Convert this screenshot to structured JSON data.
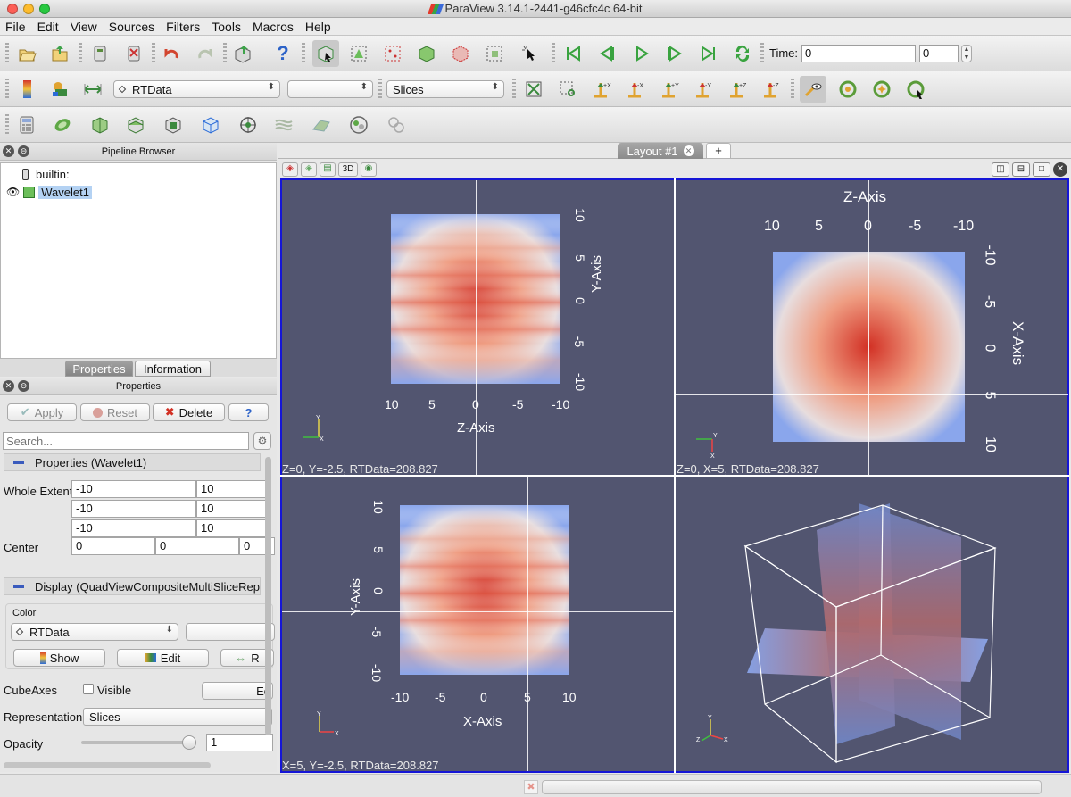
{
  "window": {
    "title": "ParaView 3.14.1-2441-g46cfc4c 64-bit"
  },
  "menu": [
    "File",
    "Edit",
    "View",
    "Sources",
    "Filters",
    "Tools",
    "Macros",
    "Help"
  ],
  "toolbar": {
    "time_label": "Time:",
    "time_value": "0",
    "timestep_value": "0",
    "array_combo": "RTData",
    "component_combo": "",
    "representation_combo": "Slices"
  },
  "pipeline": {
    "header": "Pipeline Browser",
    "root": "builtin:",
    "source": "Wavelet1"
  },
  "tabs": {
    "properties": "Properties",
    "information": "Information"
  },
  "properties": {
    "header": "Properties",
    "apply": "Apply",
    "reset": "Reset",
    "delete": "Delete",
    "help": "?",
    "search_placeholder": "Search...",
    "section_props": "Properties (Wavelet1)",
    "whole_extent_label": "Whole Extent",
    "whole_extent": [
      [
        "-10",
        "10"
      ],
      [
        "-10",
        "10"
      ],
      [
        "-10",
        "10"
      ]
    ],
    "center_label": "Center",
    "center": [
      "0",
      "0",
      "0"
    ],
    "section_display": "Display (QuadViewCompositeMultiSliceRepre",
    "color_label": "Color",
    "color_combo": "RTData",
    "show": "Show",
    "edit": "Edit",
    "rescale": "R",
    "cubeaxes_label": "CubeAxes",
    "visible_label": "Visible",
    "cubeaxes_edit": "Ed",
    "representation_label": "Representation",
    "representation_value": "Slices",
    "opacity_label": "Opacity",
    "opacity_value": "1"
  },
  "view": {
    "layout_tab": "Layout #1",
    "add_tab": "+",
    "mode_3d": "3D",
    "top_left": {
      "x_ticks": [
        "10",
        "5",
        "0",
        "-5",
        "-10"
      ],
      "y_ticks": [
        "10",
        "5",
        "0",
        "-5",
        "-10"
      ],
      "x_title": "Z-Axis",
      "y_title": "Y-Axis",
      "probe": "Z=0, Y=-2.5, RTData=208.827"
    },
    "top_right": {
      "x_ticks": [
        "10",
        "5",
        "0",
        "-5",
        "-10"
      ],
      "y_ticks": [
        "-10",
        "-5",
        "0",
        "5",
        "10"
      ],
      "x_title": "Z-Axis",
      "y_title": "X-Axis",
      "probe": "Z=0, X=5, RTData=208.827"
    },
    "bottom_left": {
      "x_ticks": [
        "-10",
        "-5",
        "0",
        "5",
        "10"
      ],
      "y_ticks": [
        "10",
        "5",
        "0",
        "-5",
        "-10"
      ],
      "x_title": "X-Axis",
      "y_title": "Y-Axis",
      "probe": "X=5, Y=-2.5, RTData=208.827"
    },
    "triad": {
      "x": "X",
      "y": "Y",
      "z": "Z"
    }
  },
  "colors": {
    "view_bg": "#525570",
    "active_border": "#1515d6",
    "hot": "#d23024",
    "cold": "#8aa6ec"
  }
}
